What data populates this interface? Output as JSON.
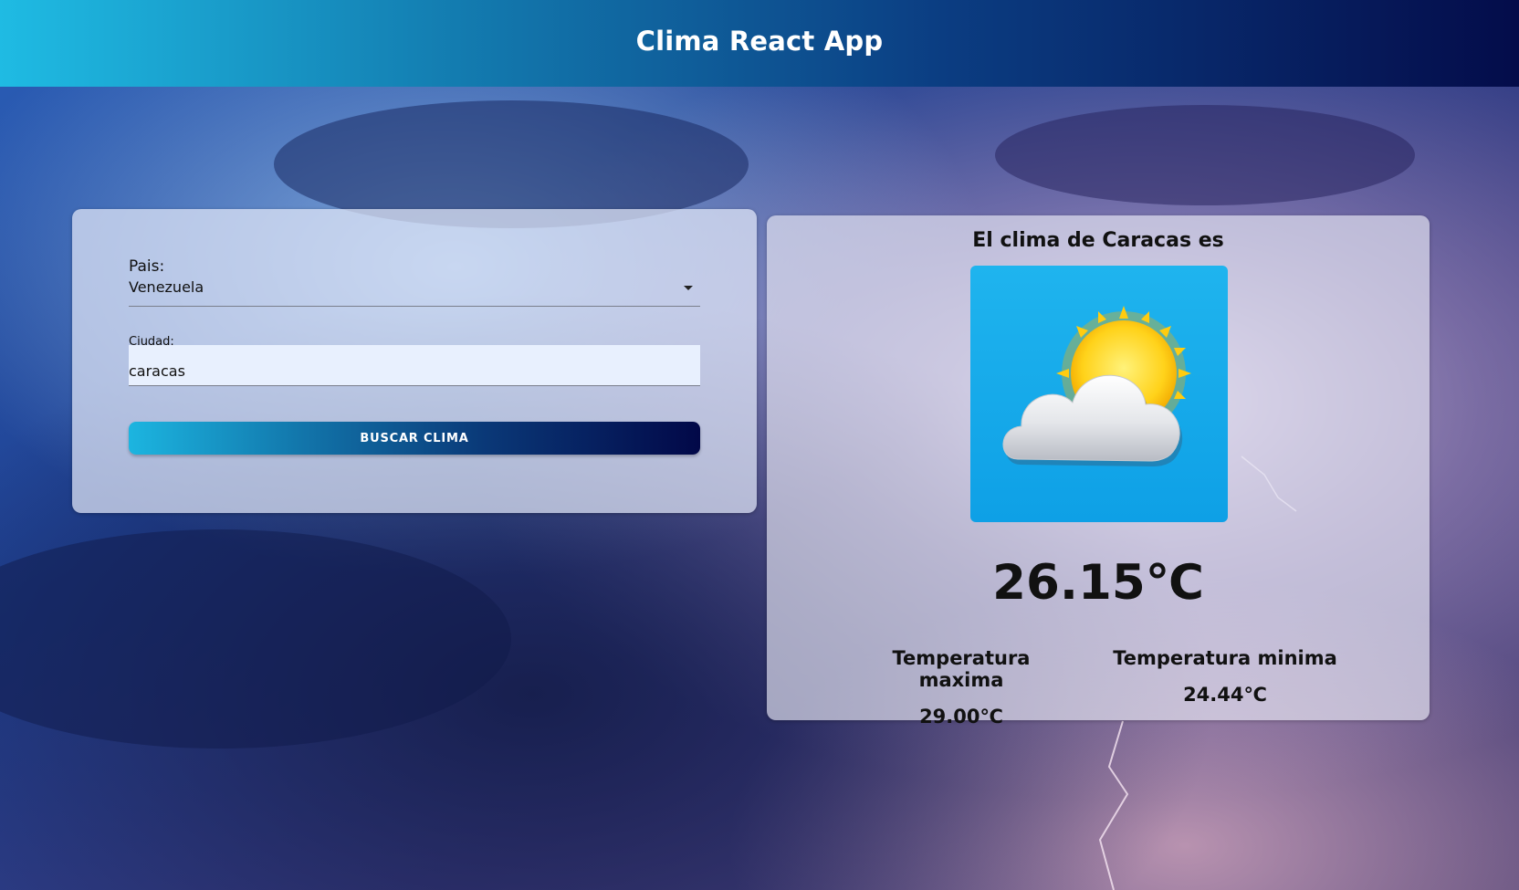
{
  "app": {
    "title": "Clima React App"
  },
  "form": {
    "country_label": "Pais:",
    "country_value": "Venezuela",
    "city_label": "Ciudad:",
    "city_value": "caracas",
    "search_button_label": "BUSCAR CLIMA"
  },
  "result": {
    "title": "El clima de Caracas es",
    "weather_icon": "partly-cloudy-icon",
    "temperature": "26.15℃",
    "max_label": "Temperatura maxima",
    "max_value": "29.00℃",
    "min_label": "Temperatura minima",
    "min_value": "24.44℃"
  },
  "colors": {
    "header_gradient_start": "#1fbbe3",
    "header_gradient_end": "#040c4a",
    "icon_background": "#0ea0e6"
  }
}
